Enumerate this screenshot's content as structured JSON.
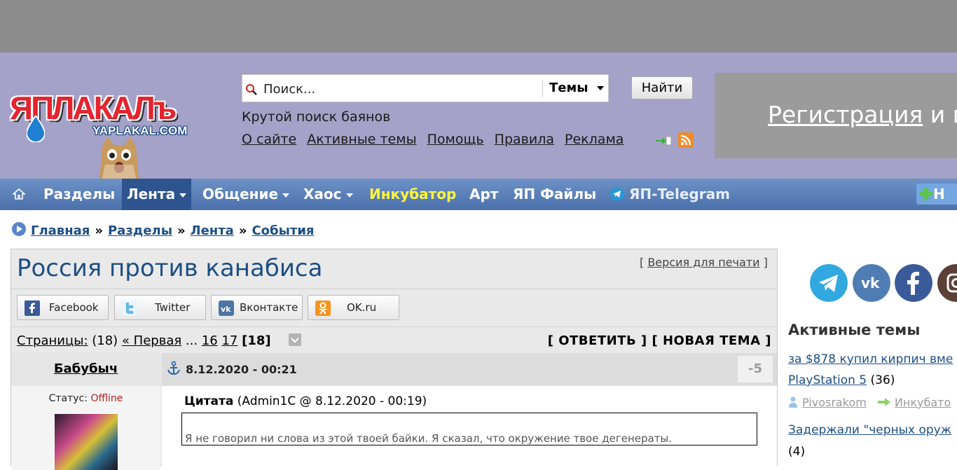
{
  "header": {
    "logo_text": "ЯПЛАКАЛъ",
    "logo_domain": "YAPLAKAL.COM",
    "search": {
      "placeholder": "Поиск...",
      "scope": "Темы",
      "button": "Найти"
    },
    "tagline": "Крутой поиск баянов",
    "links": [
      "О сайте",
      "Активные темы",
      "Помощь",
      "Правила",
      "Реклама"
    ],
    "register": {
      "link": "Регистрация",
      "rest": "и в"
    }
  },
  "nav": {
    "items": [
      {
        "label": "Разделы"
      },
      {
        "label": "Лента"
      },
      {
        "label": "Общение"
      },
      {
        "label": "Хаос"
      },
      {
        "label": "Инкубатор"
      },
      {
        "label": "Арт"
      },
      {
        "label": "ЯП Файлы"
      },
      {
        "label": "ЯП-Telegram"
      }
    ],
    "plus_label": "Н"
  },
  "breadcrumb": [
    "Главная",
    "Разделы",
    "Лента",
    "События"
  ],
  "breadcrumb_sep": "»",
  "topic": {
    "title": "Россия против канабиса",
    "print_version": "Версия для печати",
    "share": [
      "Facebook",
      "Twitter",
      "Вконтакте",
      "OK.ru"
    ],
    "pages": {
      "label": "Страницы:",
      "count": "(18)",
      "first": "« Первая",
      "ellipsis": "...",
      "p16": "16",
      "p17": "17",
      "current": "[18]"
    },
    "reply": "[ ОТВЕТИТЬ ]",
    "new_topic": "[ НОВАЯ ТЕМА ]"
  },
  "post": {
    "author": "Бабубыч",
    "date": "8.12.2020 - 00:21",
    "rating": "-5",
    "status_label": "Статус:",
    "status_value": "Offline",
    "quote_label": "Цитата",
    "quote_meta": "(Admin1C @ 8.12.2020 - 00:19)",
    "quote_text": "Я не говорил ни слова из этой твоей байки. Я сказал, что окружение твое дегенераты."
  },
  "sidebar": {
    "active_title": "Активные темы",
    "topic1_line1": "за $878 купил кирпич вме",
    "topic1_line2": "PlayStation 5",
    "topic1_count": "(36)",
    "meta_user": "Pivosrakom",
    "meta_section": "Инкубато",
    "topic2_line1": "Задержали \"черных оруж",
    "topic2_count": "(4)"
  },
  "colors": {
    "header_bg": "#a4a2c8",
    "nav_bg": "#5a80b8",
    "link": "#1d4f84",
    "incubator": "#fff53a",
    "offline": "#b21f1f"
  }
}
